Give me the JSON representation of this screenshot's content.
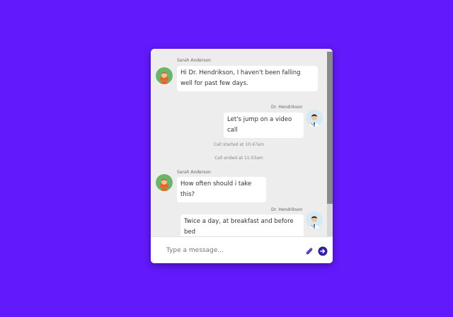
{
  "chat": {
    "messages": [
      {
        "sender": "Sarah Anderson",
        "text": "Hi Dr. Hendrikson, I haven't been falling well for past few days."
      },
      {
        "sender": "Dr. Hendrikson",
        "text": "Let's jump on a video call"
      },
      {
        "system": "Call started at 10:47am"
      },
      {
        "system": "Call ended at 11:03am"
      },
      {
        "sender": "Sarah Anderson",
        "text": "How often should i take this?"
      },
      {
        "sender": "Dr. Hendrikson",
        "text": "Twice a day, at breakfast and before bed"
      }
    ],
    "composer": {
      "placeholder": "Type a message...",
      "attach_icon": "paperclip-icon",
      "send_icon": "arrow-right-circle-icon"
    }
  },
  "colors": {
    "background": "#6219fb",
    "panel": "#ededed",
    "bubble": "#ffffff",
    "accent": "#2d1fa0",
    "patient_avatar_bg": "#6bb56b",
    "doctor_avatar_bg": "#d6e8f2"
  }
}
